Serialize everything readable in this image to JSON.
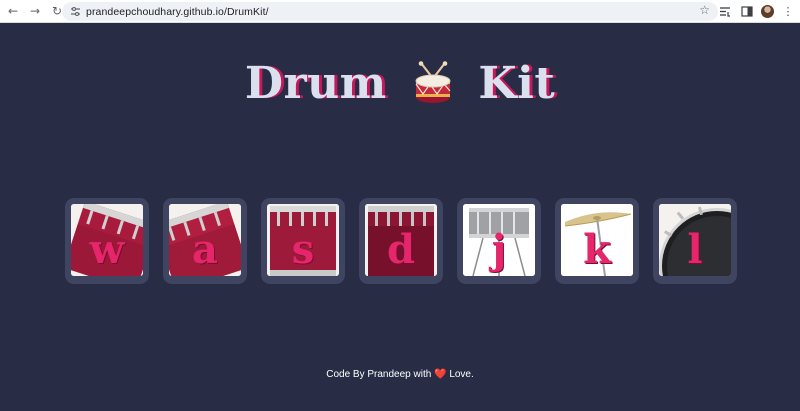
{
  "browser": {
    "url": "prandeepchoudhary.github.io/DrumKit/",
    "back_icon": "arrow-left-icon",
    "forward_icon": "arrow-right-icon",
    "reload_icon": "reload-icon"
  },
  "page": {
    "title_left": "Drum",
    "title_right": "Kit",
    "title_emoji": "drum-emoji",
    "keys": [
      {
        "letter": "w",
        "image": "tom-drum-1"
      },
      {
        "letter": "a",
        "image": "tom-drum-2"
      },
      {
        "letter": "s",
        "image": "tom-drum-3"
      },
      {
        "letter": "d",
        "image": "tom-drum-4"
      },
      {
        "letter": "j",
        "image": "snare-drum"
      },
      {
        "letter": "k",
        "image": "crash-cymbal"
      },
      {
        "letter": "l",
        "image": "kick-drum"
      }
    ],
    "footer_before": "Code By Prandeep with",
    "footer_after": "Love."
  },
  "colors": {
    "background": "#282c44",
    "key_border": "#3f4560",
    "letter": "#e6266b",
    "title": "#dbe0ef",
    "title_shadow": "#c7185b",
    "drum_red": "#a81b3c"
  }
}
